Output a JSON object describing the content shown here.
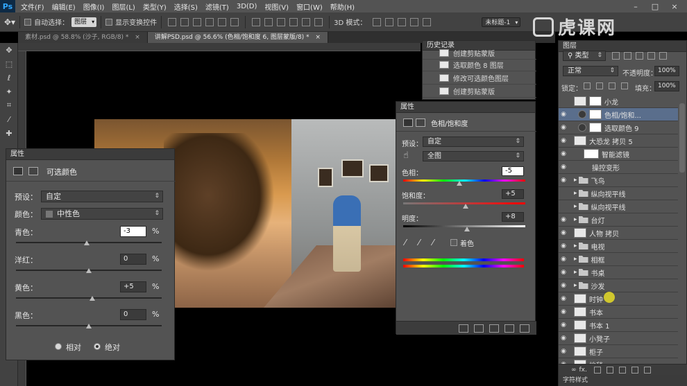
{
  "app": {
    "logo": "Ps"
  },
  "menu": [
    "文件(F)",
    "编辑(E)",
    "图像(I)",
    "图层(L)",
    "类型(Y)",
    "选择(S)",
    "滤镜(T)",
    "3D(D)",
    "视图(V)",
    "窗口(W)",
    "帮助(H)"
  ],
  "options": {
    "auto_select": "自动选择：",
    "auto_select_target": "图层",
    "show_transform": "显示变换控件",
    "mode_3d": "3D 模式：",
    "workspace": "未标题-1"
  },
  "tabs": [
    {
      "label": "素材.psd @ 58.8% (沙子, RGB/8) *",
      "close": "×"
    },
    {
      "label": "讲解PSD.psd @ 56.6% (色相/饱和度 6, 图层蒙版/8) *",
      "close": "×"
    }
  ],
  "watermark": "虎课网",
  "history": {
    "title": "历史记录",
    "items": [
      "创建剪贴蒙版",
      "选取颜色 8 图层",
      "修改可选颜色图层",
      "创建剪贴蒙版"
    ]
  },
  "selective_color": {
    "title": "属性",
    "adjust_name": "可选颜色",
    "preset_label": "预设：",
    "preset_value": "自定",
    "color_label": "颜色：",
    "color_value": "中性色",
    "sliders": [
      {
        "label": "青色：",
        "value": "-3",
        "level": -3
      },
      {
        "label": "洋红：",
        "value": "0",
        "level": 0
      },
      {
        "label": "黄色：",
        "value": "+5",
        "level": 5
      },
      {
        "label": "黑色：",
        "value": "0",
        "level": 0
      }
    ],
    "pct": "%",
    "relative": "相对",
    "absolute": "绝对"
  },
  "hue_sat": {
    "title": "属性",
    "adjust_name": "色相/饱和度",
    "preset_label": "预设：",
    "preset_value": "自定",
    "range_value": "全图",
    "hue_label": "色相：",
    "hue_value": "-5",
    "sat_label": "饱和度：",
    "sat_value": "+5",
    "light_label": "明度：",
    "light_value": "+8",
    "colorize": "着色"
  },
  "layers": {
    "title": "图层",
    "filter": "类型",
    "blend": "正常",
    "opacity_label": "不透明度：",
    "opacity_value": "100%",
    "lock_label": "锁定：",
    "fill_label": "填充：",
    "fill_value": "100%",
    "footer": "字符样式",
    "items": [
      {
        "name": "小龙",
        "kind": "mask",
        "visible": false,
        "selected": false
      },
      {
        "name": "色相/饱和...",
        "kind": "adjust",
        "visible": true,
        "selected": true
      },
      {
        "name": "选取颜色 9",
        "kind": "adjust",
        "visible": true,
        "selected": false
      },
      {
        "name": "大恐龙 拷贝 5",
        "kind": "smart",
        "visible": true,
        "selected": false
      },
      {
        "name": "智能滤镜",
        "kind": "sub",
        "visible": true,
        "selected": false
      },
      {
        "name": "操控变形",
        "kind": "sub2",
        "visible": true,
        "selected": false
      },
      {
        "name": "飞鸟",
        "kind": "folder",
        "visible": true,
        "selected": false
      },
      {
        "name": "纵向视平线",
        "kind": "folder",
        "visible": false,
        "selected": false
      },
      {
        "name": "纵向视平线",
        "kind": "folder",
        "visible": false,
        "selected": false
      },
      {
        "name": "台灯",
        "kind": "folder",
        "visible": true,
        "selected": false
      },
      {
        "name": "人物 拷贝",
        "kind": "smart",
        "visible": true,
        "selected": false
      },
      {
        "name": "电视",
        "kind": "folder",
        "visible": true,
        "selected": false
      },
      {
        "name": "相框",
        "kind": "folder",
        "visible": true,
        "selected": false
      },
      {
        "name": "书桌",
        "kind": "folder",
        "visible": true,
        "selected": false
      },
      {
        "name": "沙发",
        "kind": "folder",
        "visible": true,
        "selected": false
      },
      {
        "name": "时钟",
        "kind": "smart",
        "visible": true,
        "selected": false
      },
      {
        "name": "书本",
        "kind": "smart",
        "visible": true,
        "selected": false
      },
      {
        "name": "书本 1",
        "kind": "smart",
        "visible": true,
        "selected": false
      },
      {
        "name": "小凳子",
        "kind": "smart",
        "visible": true,
        "selected": false
      },
      {
        "name": "柜子",
        "kind": "smart",
        "visible": true,
        "selected": false
      },
      {
        "name": "地毯",
        "kind": "smart",
        "visible": true,
        "selected": false
      }
    ]
  }
}
